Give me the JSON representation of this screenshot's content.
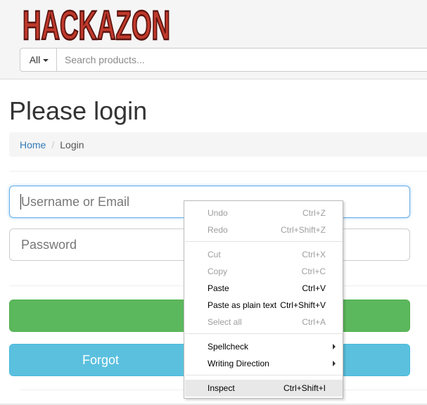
{
  "header": {
    "logo_text": "HACKAZON",
    "search": {
      "category_label": "All",
      "placeholder": "Search products..."
    }
  },
  "main": {
    "title": "Please login",
    "breadcrumb": {
      "home": "Home",
      "separator": "/",
      "current": "Login"
    },
    "form": {
      "username_placeholder": "Username or Email",
      "password_placeholder": "Password",
      "login_button_label": "",
      "forgot_button_label": "Forgot"
    }
  },
  "context_menu": {
    "undo": {
      "label": "Undo",
      "shortcut": "Ctrl+Z"
    },
    "redo": {
      "label": "Redo",
      "shortcut": "Ctrl+Shift+Z"
    },
    "cut": {
      "label": "Cut",
      "shortcut": "Ctrl+X"
    },
    "copy": {
      "label": "Copy",
      "shortcut": "Ctrl+C"
    },
    "paste": {
      "label": "Paste",
      "shortcut": "Ctrl+V"
    },
    "paste_plain": {
      "label": "Paste as plain text",
      "shortcut": "Ctrl+Shift+V"
    },
    "select_all": {
      "label": "Select all",
      "shortcut": "Ctrl+A"
    },
    "spellcheck": {
      "label": "Spellcheck"
    },
    "writing_direction": {
      "label": "Writing Direction"
    },
    "inspect": {
      "label": "Inspect",
      "shortcut": "Ctrl+Shift+I"
    }
  },
  "colors": {
    "logo_fill": "#c0392b",
    "login_button": "#5cb85c",
    "forgot_button": "#5bc0de",
    "link": "#337ab7"
  }
}
